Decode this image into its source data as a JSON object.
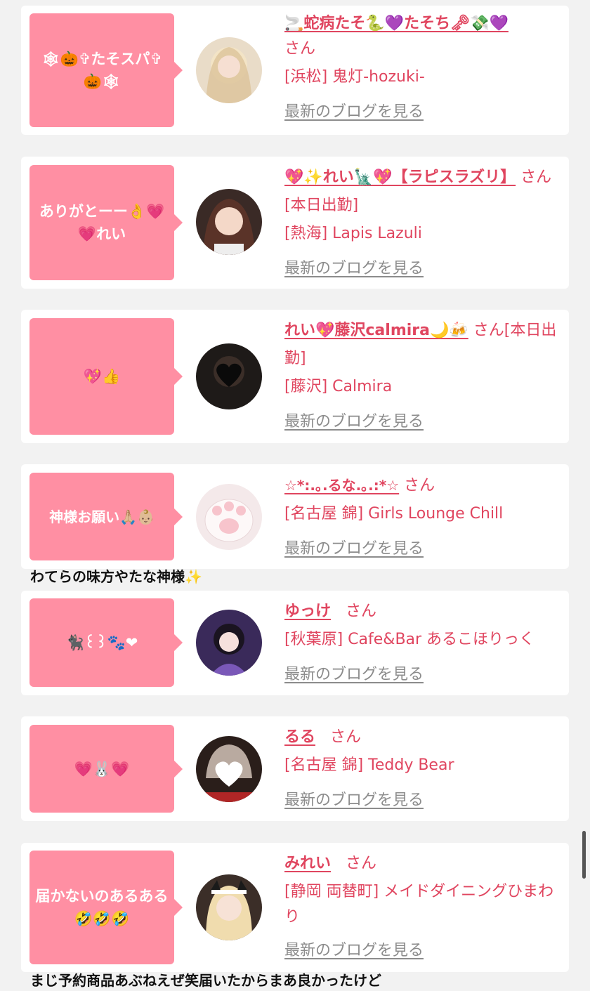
{
  "entries": [
    {
      "message": "🕸🎃✞たそスパ✞🎃🕸",
      "name": "🚬蛇病たそ🐍💜たそち🗝💸💜",
      "suffix": "さん",
      "shop": "[浜松] 鬼灯-hozuki-",
      "blog_link": "最新のブログを見る"
    },
    {
      "message": "ありがとーー👌💗💗れい",
      "name": "💖✨れい🗽💖【ラピスラズリ】",
      "suffix": "さん[本日出勤]",
      "shop": "[熱海] Lapis Lazuli",
      "blog_link": "最新のブログを見る"
    },
    {
      "message": "💖👍",
      "name": "れい💖藤沢calmira🌙🍻",
      "suffix": "さん[本日出勤]",
      "shop": "[藤沢] Calmira",
      "blog_link": "最新のブログを見る"
    },
    {
      "message": "神様お願い🙏🏼👶🏼",
      "name": "☆*:.｡.るな.｡.:*☆",
      "suffix": "さん",
      "shop": "[名古屋 錦] Girls Lounge Chill",
      "blog_link": "最新のブログを見る",
      "comment": "わてらの味方やたな神様✨"
    },
    {
      "message": "🐈‍⬛꒰꒱🐾❤",
      "name": "ゆっけ",
      "suffix": "さん",
      "shop": "[秋葉原] Cafe&Bar あるこほりっく",
      "blog_link": "最新のブログを見る"
    },
    {
      "message": "💗🐰💗",
      "name": "るる",
      "suffix": "さん",
      "shop": "[名古屋 錦] Teddy Bear",
      "blog_link": "最新のブログを見る"
    },
    {
      "message": "届かないのあるある🤣🤣🤣",
      "name": "みれい",
      "suffix": "さん",
      "shop": "[静岡 両替町] メイドダイニングひまわり",
      "blog_link": "最新のブログを見る",
      "comment": "まじ予約商品あぶねえぜ笑届いたからまあ良かったけど"
    }
  ],
  "colors": {
    "bubble": "#ff8fa3",
    "name": "#e0455f",
    "blog_link": "#8c8c8c",
    "background": "#f2f2f2"
  }
}
